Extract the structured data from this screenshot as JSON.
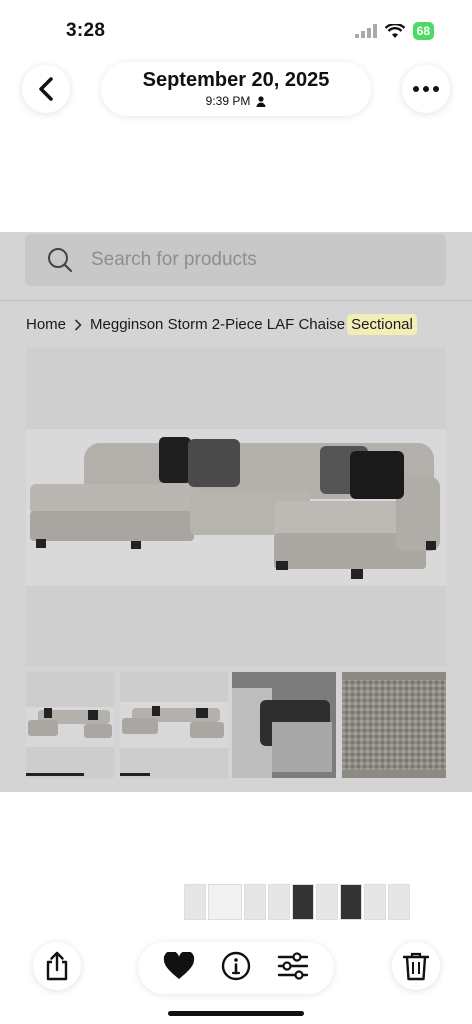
{
  "status_bar": {
    "time": "3:28",
    "battery": "68"
  },
  "header": {
    "date": "September 20, 2025",
    "time": "9:39 PM"
  },
  "photo": {
    "search_placeholder": "Search for products",
    "breadcrumb": {
      "home": "Home",
      "product": "Megginson Storm 2-Piece LAF Chaise",
      "highlighted": "Sectional"
    },
    "selected_thumbnail": 1
  },
  "icons": {
    "back": "chevron-left-icon",
    "more": "ellipsis-icon",
    "share": "share-icon",
    "favorite": "heart-icon",
    "info": "info-icon",
    "adjust": "sliders-icon",
    "delete": "trash-icon"
  }
}
